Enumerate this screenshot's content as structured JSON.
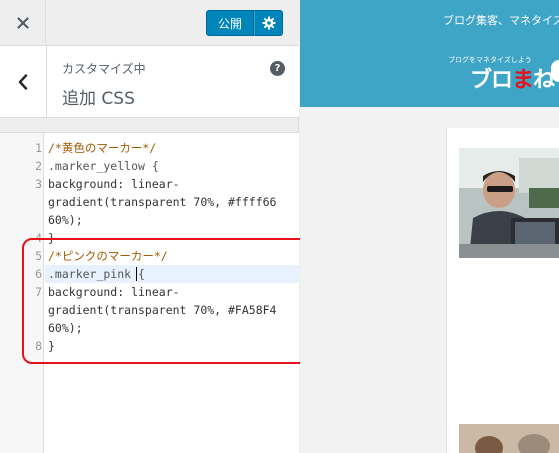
{
  "toolbar": {
    "close_icon": "close-icon",
    "publish_label": "公開",
    "gear_icon": "gear-icon"
  },
  "section": {
    "back_icon": "chevron-left-icon",
    "customizing_label": "カスタマイズ中",
    "title": "追加 CSS",
    "help_icon": "?"
  },
  "editor": {
    "lines": [
      {
        "n": "1",
        "text": "/*黄色のマーカー*/"
      },
      {
        "n": "2",
        "text": ".marker_yellow {"
      },
      {
        "n": "3",
        "text": "background: linear-"
      },
      {
        "n": "",
        "text": "gradient(transparent 70%, #ffff66"
      },
      {
        "n": "",
        "text": "60%);"
      },
      {
        "n": "4",
        "text": "}"
      },
      {
        "n": "5",
        "text": "/*ピンクのマーカー*/"
      },
      {
        "n": "6",
        "text": ".marker_pink {"
      },
      {
        "n": "7",
        "text": "background: linear-"
      },
      {
        "n": "",
        "text": "gradient(transparent 70%, #FA58F4"
      },
      {
        "n": "",
        "text": "60%);"
      },
      {
        "n": "8",
        "text": "}"
      }
    ]
  },
  "preview": {
    "tagline": "ブログ集客、マネタイズ",
    "logo_small": "ブログをマネタイズしよう",
    "logo_main_white": "ブロ",
    "logo_main_red": "ま",
    "logo_main_white2": "ね"
  },
  "colors": {
    "accent": "#0085ba",
    "highlight": "#e8101a",
    "site_header": "#3fa5c6"
  }
}
